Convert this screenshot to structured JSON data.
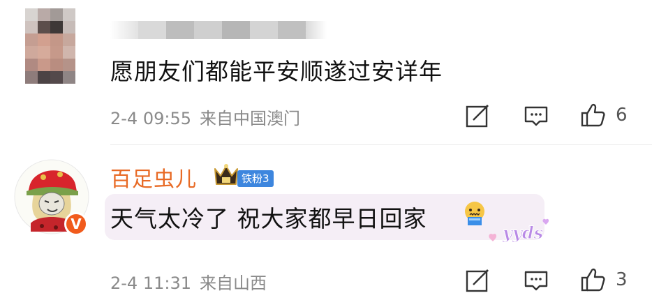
{
  "comments": [
    {
      "text": "愿朋友们都能平安顺遂过安详年",
      "time": "2-4 09:55",
      "location": "来自中国澳门",
      "likes": "6",
      "avatar_pixels": [
        "#d8d4d1",
        "#b9aaa7",
        "#a29a97",
        "#cfc9c6",
        "#cfc3bf",
        "#5c4e4b",
        "#3e3837",
        "#c7bcb8",
        "#c59e92",
        "#d2a08f",
        "#c49788",
        "#c7a89d",
        "#cfa99c",
        "#d6ab9b",
        "#c6998a",
        "#d0b6ad",
        "#b08a82",
        "#c9998a",
        "#b98d80",
        "#b59389",
        "#8e7c7b",
        "#4c4345",
        "#54494b",
        "#8f8585"
      ]
    },
    {
      "username": "百足虫儿",
      "fan_badge": "铁粉3",
      "text": "天气太冷了 祝大家都早日回家",
      "sticker_text": "yyds",
      "time": "2-4 11:31",
      "location": "来自山西",
      "likes": "3"
    }
  ],
  "colors": {
    "username": "#e86a25",
    "badge_blue": "#3d86de",
    "vip_orange": "#f15b1c",
    "bubble": "#f5eef6",
    "meta_gray": "#8a8a8a"
  },
  "icons": [
    "share-edit-icon",
    "reply-message-icon",
    "thumbs-up-icon",
    "crown-icon",
    "verified-v-icon",
    "cold-face-emoji-icon",
    "yyds-sticker-icon"
  ]
}
